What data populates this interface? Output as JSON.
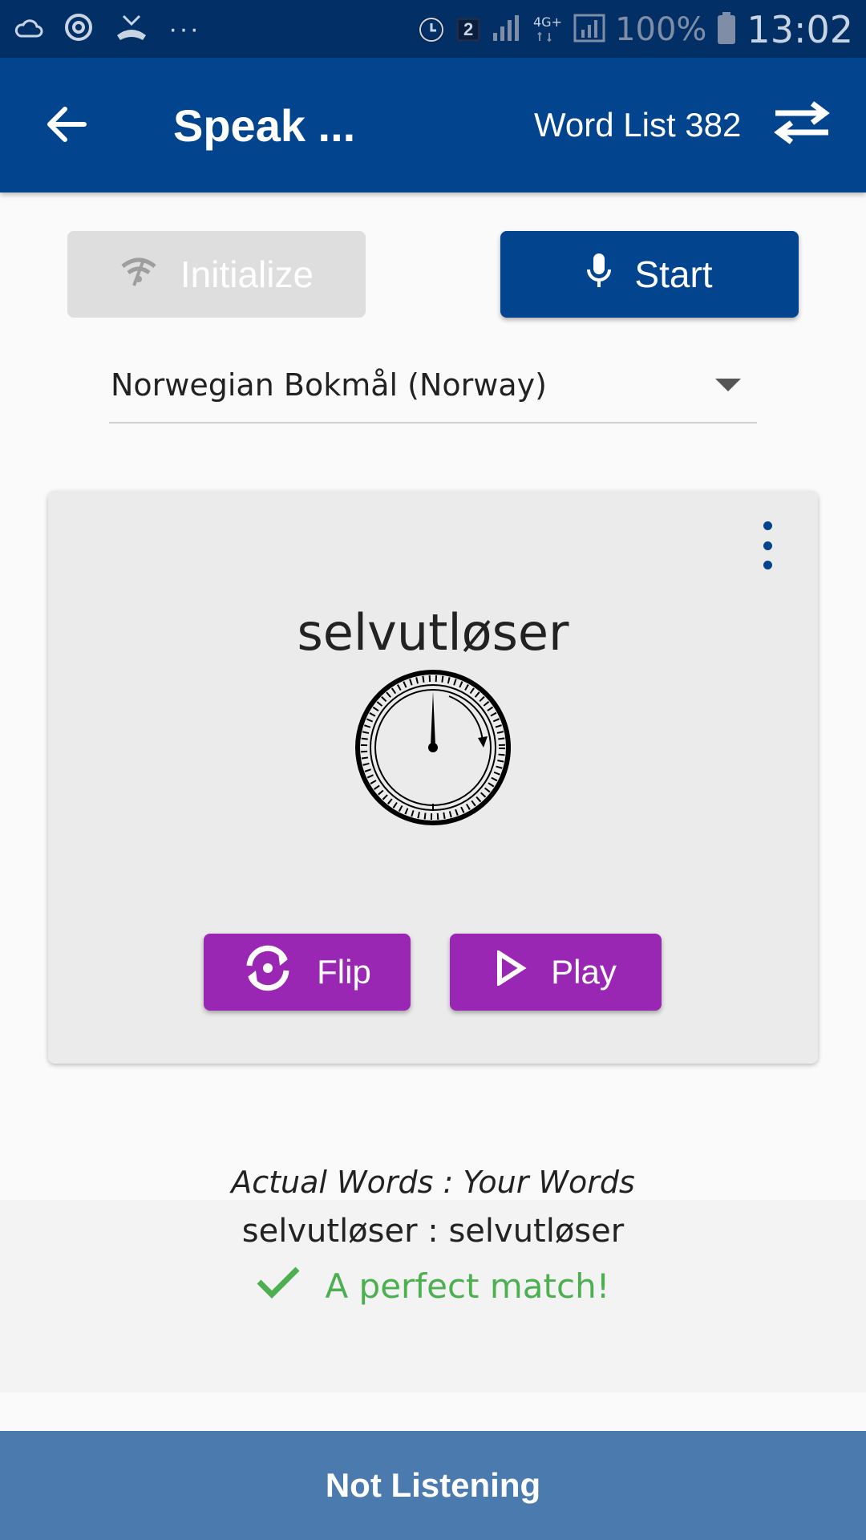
{
  "status_bar": {
    "notification_count": "2",
    "dots": "···",
    "battery": "100%",
    "time": "13:02",
    "icons": [
      "cloud-icon",
      "sync-icon",
      "missed-call-icon",
      "alarm-icon",
      "signal-icon",
      "network-4g-icon",
      "signal-bars-icon",
      "battery-icon"
    ]
  },
  "app_bar": {
    "title": "Speak ...",
    "word_list": "Word List 382",
    "icons": [
      "back-arrow-icon",
      "swap-icon"
    ]
  },
  "controls": {
    "initialize_label": "Initialize",
    "start_label": "Start",
    "initialize_icon": "wifi-off-icon",
    "start_icon": "microphone-icon"
  },
  "language": {
    "selected": "Norwegian Bokmål (Norway)"
  },
  "card": {
    "word": "selvutløser",
    "image_icon": "stopwatch-dial-icon",
    "flip_label": "Flip",
    "play_label": "Play",
    "menu_icon": "more-vert-icon"
  },
  "result": {
    "header": "Actual Words : Your Words",
    "words": "selvutløser : selvutløser",
    "match_text": "A perfect match!",
    "match_icon": "check-icon"
  },
  "bottom_bar": {
    "label": "Not Listening"
  },
  "colors": {
    "primary": "#03448f",
    "accent": "#9a27b3",
    "success": "#4caf50",
    "bottom_bar": "#4b7aae"
  }
}
